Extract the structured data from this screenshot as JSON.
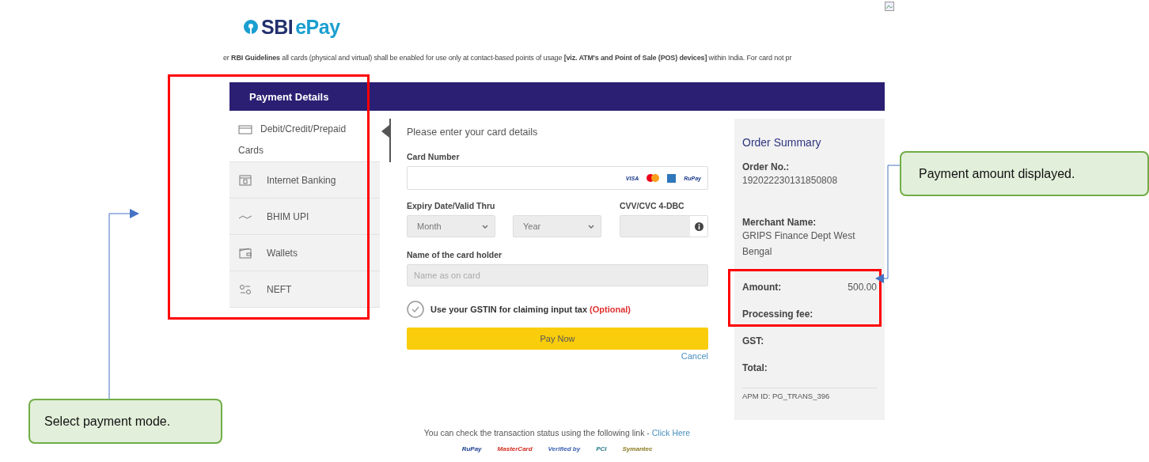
{
  "logo": {
    "brand": "SBI",
    "suffix": "ePay"
  },
  "notice": "er **RBI Guidelines** all cards (physical and virtual) shall be enabled for use only at contact-based points of usage **[viz. ATM's and Point of Sale (POS) devices]** within India. For card not pr",
  "header": {
    "title": "Payment Details"
  },
  "payment_modes": [
    {
      "label": "Debit/Credit/Prepaid Cards",
      "kind": "card",
      "selected": true
    },
    {
      "label": "Internet Banking",
      "kind": "bank",
      "selected": false
    },
    {
      "label": "BHIM UPI",
      "kind": "upi",
      "selected": false
    },
    {
      "label": "Wallets",
      "kind": "wallet",
      "selected": false
    },
    {
      "label": "NEFT",
      "kind": "neft",
      "selected": false
    }
  ],
  "form": {
    "intro": "Please enter your card details",
    "card_number": {
      "label": "Card Number",
      "brands": [
        {
          "kind": "text",
          "label": "VISA"
        },
        {
          "kind": "mastercard"
        },
        {
          "kind": "amex"
        },
        {
          "kind": "text",
          "label": "RuPay"
        }
      ]
    },
    "expiry": {
      "label": "Expiry Date/Valid Thru",
      "month": "Month",
      "year": "Year"
    },
    "cvv": {
      "label": "CVV/CVC 4-DBC"
    },
    "holder": {
      "label": "Name of the card holder",
      "placeholder": "Name as on card"
    },
    "gstin": {
      "label": "Use your GSTIN for claiming input tax",
      "optional": "(Optional)"
    },
    "pay_button": "Pay Now",
    "cancel": "Cancel"
  },
  "order_summary": {
    "title": "Order Summary",
    "order_no": {
      "label": "Order No.:",
      "value": "192022230131850808"
    },
    "merchant": {
      "label": "Merchant Name:",
      "value": "GRIPS Finance Dept West Bengal"
    },
    "rows": [
      {
        "label": "Amount:",
        "value": "500.00"
      },
      {
        "label": "Processing fee:"
      },
      {
        "label": "GST:"
      },
      {
        "label": "Total:"
      }
    ],
    "apm_id": "APM ID: PG_TRANS_396"
  },
  "footer": {
    "text": "You can check the transaction status using the following link - ",
    "link": "Click Here",
    "badges": [
      {
        "label": "RuPay",
        "color": "#1d3f8f"
      },
      {
        "label": "MasterCard",
        "color": "#d42a1e"
      },
      {
        "label": "Verified by",
        "color": "#3a5fb0"
      },
      {
        "label": "PCI",
        "color": "#2a7a8a"
      },
      {
        "label": "Symantec",
        "color": "#8a7a20"
      }
    ]
  },
  "callouts": [
    {
      "text": "Payment amount displayed."
    },
    {
      "text": "Select payment mode."
    }
  ]
}
